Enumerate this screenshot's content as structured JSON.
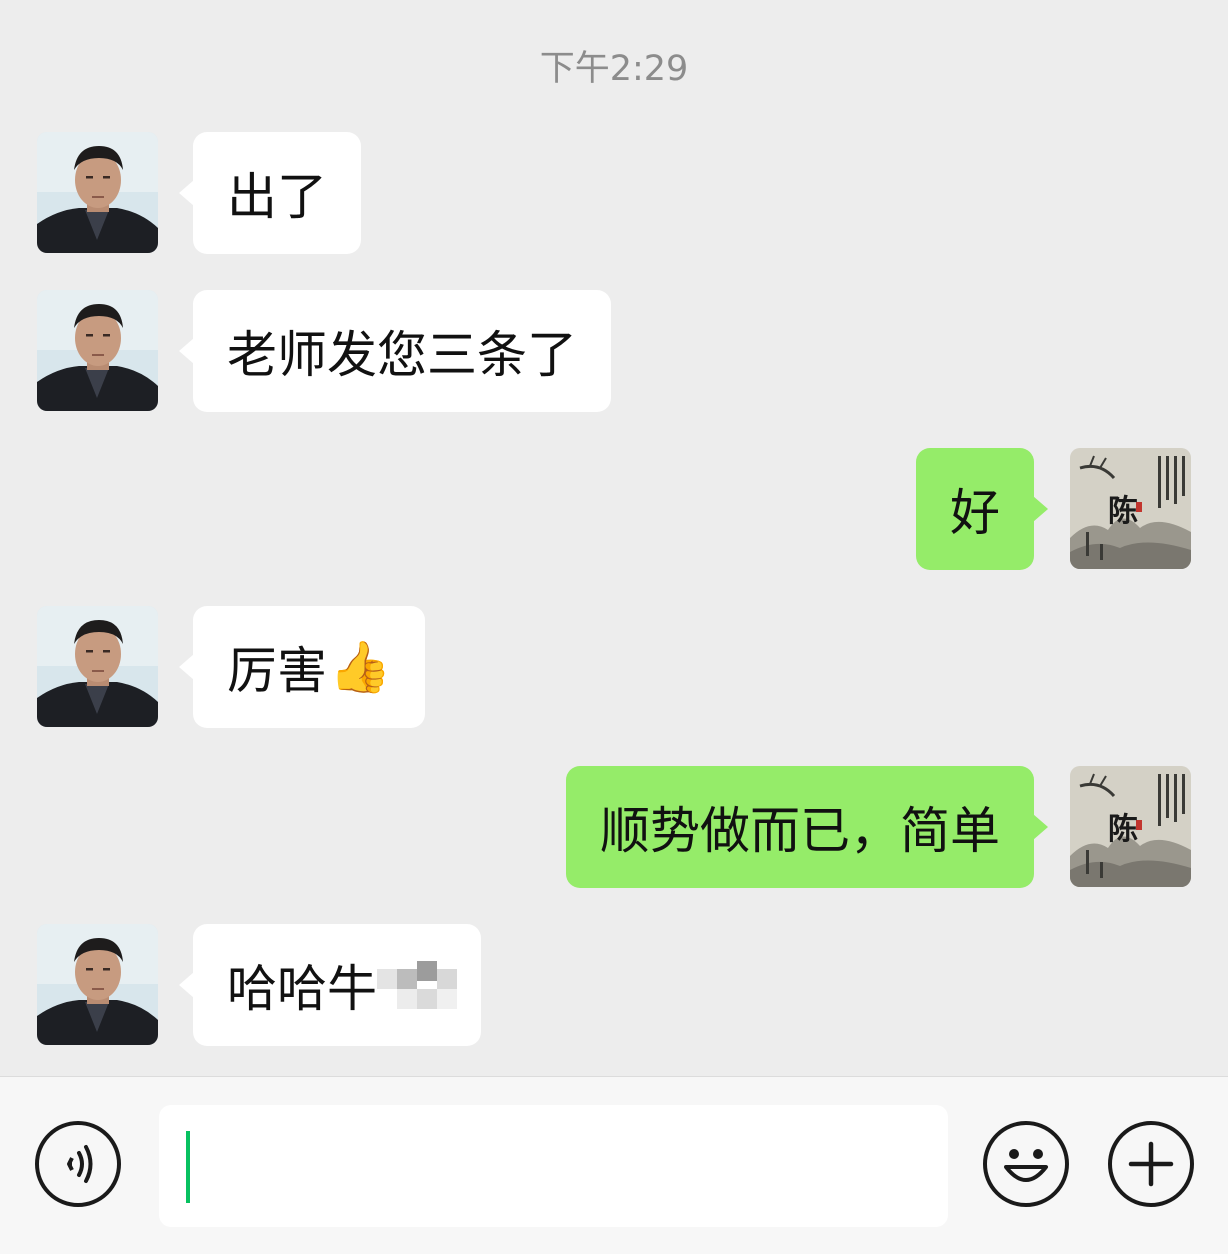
{
  "chat": {
    "timestamp": "下午2:29",
    "messages": [
      {
        "side": "in",
        "text": "出了"
      },
      {
        "side": "in",
        "text": "老师发您三条了"
      },
      {
        "side": "out",
        "text": "好"
      },
      {
        "side": "in",
        "text": "厉害",
        "emoji": "👍"
      },
      {
        "side": "out",
        "text": "顺势做而已，简单"
      },
      {
        "side": "in",
        "text": "哈哈牛"
      }
    ]
  },
  "self_avatar": {
    "seal_text": "陈"
  },
  "input_bar": {
    "voice_icon": "voice-icon",
    "emoji_icon": "emoji-icon",
    "plus_icon": "plus-icon",
    "value": ""
  },
  "colors": {
    "background": "#ededed",
    "incoming_bubble": "#ffffff",
    "outgoing_bubble": "#95ec69",
    "caret": "#07c160"
  }
}
